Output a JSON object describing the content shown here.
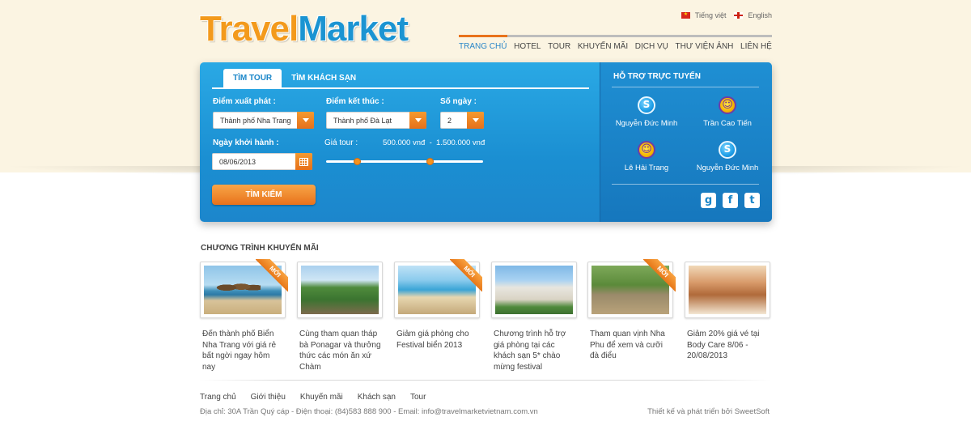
{
  "brand": {
    "logo_part1": "Travel",
    "logo_part2": "Market"
  },
  "languages": [
    {
      "label": "Tiếng việt",
      "flag": "vn-flag-icon"
    },
    {
      "label": "English",
      "flag": "uk-flag-icon"
    }
  ],
  "nav": {
    "items": [
      "TRANG CHỦ",
      "HOTEL",
      "TOUR",
      "KHUYẾN MÃI",
      "DỊCH VỤ",
      "THƯ VIỆN ẢNH",
      "LIÊN HỆ"
    ],
    "active": "TRANG CHỦ",
    "accent": "#e8731c"
  },
  "search": {
    "tabs": [
      "TÌM TOUR",
      "TÌM KHÁCH SẠN"
    ],
    "active_tab": "TÌM TOUR",
    "departure_label": "Điểm xuất phát :",
    "departure_value": "Thành phố Nha Trang",
    "destination_label": "Điểm kết thúc :",
    "destination_value": "Thành phố Đà Lạt",
    "days_label": "Số ngày :",
    "days_value": "2",
    "date_label": "Ngày khởi hành :",
    "date_value": "08/06/2013",
    "price_label": "Giá tour :",
    "price_min": "500.000 vnđ",
    "price_sep": "-",
    "price_max": "1.500.000 vnđ",
    "slider_min_fraction": 0.2,
    "slider_max_fraction": 0.66,
    "button": "TÌM KIẾM",
    "panel_color": "#1b8fd2",
    "button_color": "#e8721c"
  },
  "support": {
    "title": "HỖ TRỢ TRỰC TUYẾN",
    "contacts": [
      {
        "name": "Nguyễn Đức Minh",
        "icon": "skype-icon"
      },
      {
        "name": "Trần Cao Tiến",
        "icon": "yahoo-messenger-icon"
      },
      {
        "name": "Lê Hải Trang",
        "icon": "yahoo-messenger-icon"
      },
      {
        "name": "Nguyễn Đức Minh",
        "icon": "skype-icon"
      }
    ],
    "social": [
      {
        "label": "g",
        "icon": "google-plus-icon"
      },
      {
        "label": "f",
        "icon": "facebook-icon"
      },
      {
        "label": "t",
        "icon": "twitter-icon"
      }
    ]
  },
  "promotions": {
    "title": "CHƯƠNG TRÌNH KHUYẾN MÃI",
    "ribbon": "MỚI",
    "items": [
      {
        "caption": "Đến thành phố  Biển Nha Trang với giá rẻ bất ngời ngay hôm nay",
        "new": true
      },
      {
        "caption": "Cùng tham quan tháp bà Ponagar và thưởng thức các món ăn xứ Chàm",
        "new": false
      },
      {
        "caption": "Giảm giá phòng cho Festival biển 2013",
        "new": true
      },
      {
        "caption": "Chương trình hỗ trợ giá phòng tại các khách sạn 5* chào mừng festival",
        "new": false
      },
      {
        "caption": "Tham quan vịnh Nha Phu để xem và cưỡi đà điểu",
        "new": true
      },
      {
        "caption": "Giảm 20% giá vé tại Body Care 8/06 - 20/08/2013",
        "new": false
      }
    ]
  },
  "footer": {
    "links": [
      "Trang chủ",
      "Giới thiệu",
      "Khuyến mãi",
      "Khách sạn",
      "Tour"
    ],
    "address": "Địa chỉ: 30A Trần Quý cáp - Điện thoại: (84)583 888 900 - Email: info@travelmarketvietnam.com.vn",
    "credit": "Thiết kế và phát triển bởi SweetSoft"
  }
}
